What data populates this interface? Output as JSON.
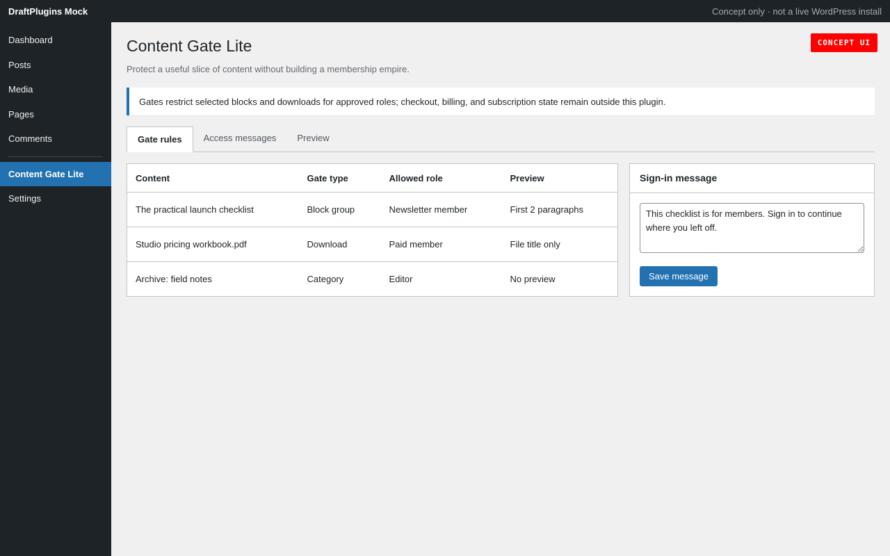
{
  "topbar": {
    "brand": "DraftPlugins Mock",
    "note": "Concept only · not a live WordPress install"
  },
  "sidebar": {
    "items": [
      "Dashboard",
      "Posts",
      "Media",
      "Pages",
      "Comments"
    ],
    "active": "Content Gate Lite",
    "settings": "Settings"
  },
  "badge": "CONCEPT UI",
  "page": {
    "title": "Content Gate Lite",
    "subtitle": "Protect a useful slice of content without building a membership empire."
  },
  "notice": "Gates restrict selected blocks and downloads for approved roles; checkout, billing, and subscription state remain outside this plugin.",
  "tabs": [
    "Gate rules",
    "Access messages",
    "Preview"
  ],
  "table": {
    "headers": [
      "Content",
      "Gate type",
      "Allowed role",
      "Preview"
    ],
    "rows": [
      [
        "The practical launch checklist",
        "Block group",
        "Newsletter member",
        "First 2 paragraphs"
      ],
      [
        "Studio pricing workbook.pdf",
        "Download",
        "Paid member",
        "File title only"
      ],
      [
        "Archive: field notes",
        "Category",
        "Editor",
        "No preview"
      ]
    ]
  },
  "panel": {
    "title": "Sign-in message",
    "message": "This checklist is for members. Sign in to continue where you left off.",
    "save_label": "Save message"
  },
  "colors": {
    "accent": "#2271b1",
    "admin_bar": "#1d2327",
    "badge": "#ff0000"
  }
}
